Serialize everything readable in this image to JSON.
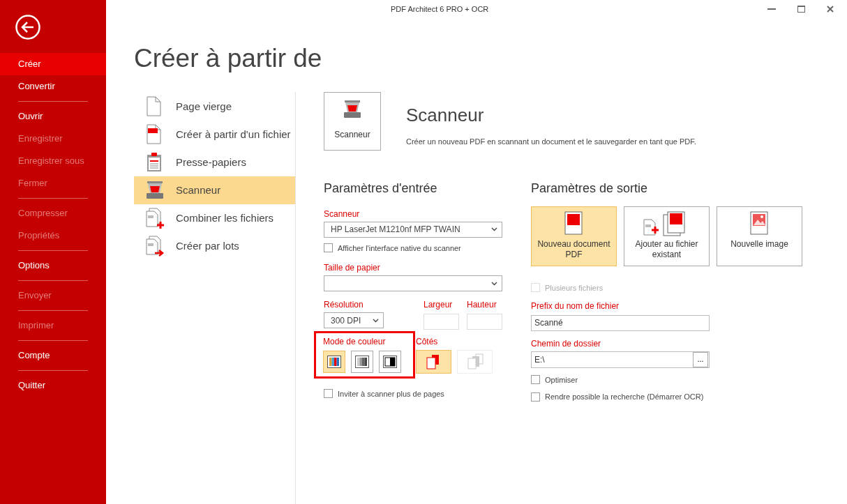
{
  "window": {
    "title": "PDF Architect 6 PRO + OCR"
  },
  "sidebar": {
    "groups": [
      {
        "items": [
          {
            "label": "Créer",
            "selected": true,
            "disabled": false
          },
          {
            "label": "Convertir",
            "selected": false,
            "disabled": false
          }
        ]
      },
      {
        "items": [
          {
            "label": "Ouvrir",
            "selected": false,
            "disabled": false
          },
          {
            "label": "Enregistrer",
            "selected": false,
            "disabled": true
          },
          {
            "label": "Enregistrer sous",
            "selected": false,
            "disabled": true
          },
          {
            "label": "Fermer",
            "selected": false,
            "disabled": true
          }
        ]
      },
      {
        "items": [
          {
            "label": "Compresser",
            "selected": false,
            "disabled": true
          },
          {
            "label": "Propriétés",
            "selected": false,
            "disabled": true
          }
        ]
      },
      {
        "items": [
          {
            "label": "Options",
            "selected": false,
            "disabled": false
          }
        ]
      },
      {
        "items": [
          {
            "label": "Envoyer",
            "selected": false,
            "disabled": true
          }
        ]
      },
      {
        "items": [
          {
            "label": "Imprimer",
            "selected": false,
            "disabled": true
          }
        ]
      },
      {
        "items": [
          {
            "label": "Compte",
            "selected": false,
            "disabled": false
          }
        ]
      },
      {
        "items": [
          {
            "label": "Quitter",
            "selected": false,
            "disabled": false
          }
        ]
      }
    ]
  },
  "page_title": "Créer à partir de",
  "sources": [
    {
      "label": "Page vierge",
      "kind": "blank",
      "selected": false
    },
    {
      "label": "Créer à partir d'un fichier",
      "kind": "file",
      "selected": false
    },
    {
      "label": "Presse-papiers",
      "kind": "clipboard",
      "selected": false
    },
    {
      "label": "Scanneur",
      "kind": "scanner",
      "selected": true
    },
    {
      "label": "Combiner les fichiers",
      "kind": "combine",
      "selected": false
    },
    {
      "label": "Créer par lots",
      "kind": "batch",
      "selected": false
    }
  ],
  "header": {
    "tile_label": "Scanneur",
    "title": "Scanneur",
    "description": "Créer un nouveau PDF en scannant un document et le sauvegarder en tant que PDF."
  },
  "input": {
    "heading": "Paramètres d'entrée",
    "scanner": {
      "label": "Scanneur",
      "value": "HP LaserJet M1210nf MFP TWAIN"
    },
    "native_ui": {
      "label": "Afficher l'interface native du scanner",
      "checked": false
    },
    "paper_size": {
      "label": "Taille de papier"
    },
    "resolution": {
      "label": "Résolution",
      "value": "300 DPI"
    },
    "width": {
      "label": "Largeur"
    },
    "height": {
      "label": "Hauteur"
    },
    "color_mode": {
      "label": "Mode de couleur",
      "highlighted": true,
      "options": [
        {
          "kind": "color",
          "selected": true
        },
        {
          "kind": "gray",
          "selected": false
        },
        {
          "kind": "bw",
          "selected": false
        }
      ]
    },
    "sides": {
      "label": "Côtés",
      "options": [
        {
          "kind": "single",
          "selected": true,
          "disabled": false
        },
        {
          "kind": "duplex",
          "selected": false,
          "disabled": true
        }
      ]
    },
    "more_pages": {
      "label": "Inviter à scanner plus de pages",
      "checked": false
    }
  },
  "output": {
    "heading": "Paramètres de sortie",
    "targets": [
      {
        "label": "Nouveau document PDF",
        "kind": "new_pdf",
        "selected": true
      },
      {
        "label": "Ajouter au fichier existant",
        "kind": "append",
        "selected": false
      },
      {
        "label": "Nouvelle image",
        "kind": "image",
        "selected": false
      }
    ],
    "multiple_files": {
      "label": "Plusieurs fichiers",
      "checked": false,
      "disabled": true
    },
    "prefix": {
      "label": "Prefix du nom de fichier",
      "value": "Scanné"
    },
    "folder": {
      "label": "Chemin de dossier",
      "value": "E:\\",
      "browse": "..."
    },
    "optimize": {
      "label": "Optimiser",
      "checked": false,
      "disabled": false
    },
    "ocr": {
      "label": "Rendre possible la recherche (Démarrer OCR)",
      "checked": false,
      "disabled": false
    }
  }
}
